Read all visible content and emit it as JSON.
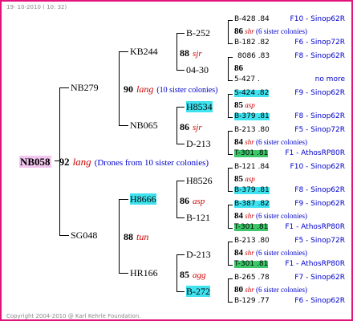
{
  "header": {
    "date": "19- 10-2010 ( 10: 32)"
  },
  "footer": {
    "copyright": "Copyright 2004-2010 @ Karl Kehrle Foundation."
  },
  "root": {
    "id": "NB058",
    "gen": "92",
    "origin": "lang",
    "note": "(Drones from 10 sister colonies)"
  },
  "gen2": [
    {
      "id": "NB279",
      "gen": "90",
      "origin": "lang",
      "note": "(10 sister colonies)"
    },
    {
      "id": "SG048",
      "gen": "88",
      "origin": "tun"
    }
  ],
  "gen3": [
    {
      "id": "KB244",
      "gen": "88",
      "origin": "sjr"
    },
    {
      "id": "NB065",
      "gen": "86",
      "origin": "sjr"
    },
    {
      "id": "H8666",
      "gen": "86",
      "origin": "asp"
    },
    {
      "id": "HR166",
      "gen": "85",
      "origin": "agg"
    }
  ],
  "gen4": [
    {
      "id": "B-252"
    },
    {
      "id": "04-30"
    },
    {
      "id": "H8534"
    },
    {
      "id": "D-213"
    },
    {
      "id": "H8526"
    },
    {
      "id": "B-121"
    },
    {
      "id": "D-213"
    },
    {
      "id": "B-272"
    }
  ],
  "gen5": [
    {
      "a": "B-428 .84",
      "a_src": "F10 - Sinop62R",
      "gen": "86",
      "origin": "shr",
      "note": "(6 sister colonies)",
      "b": "B-182 .82",
      "b_src": "F6 - Sinop72R"
    },
    {
      "a": "8086 .83",
      "a_src": "F8 - Sinop62R",
      "gen": "86",
      "origin": "",
      "note": "",
      "b": "5-427 .",
      "b_src": "no more"
    },
    {
      "a": "S-424 .82",
      "a_src": "F9 - Sinop62R",
      "gen": "85",
      "origin": "asp",
      "note": "",
      "b": "B-379 .81",
      "b_src": "F8 - Sinop62R"
    },
    {
      "a": "B-213 .80",
      "a_src": "F5 - Sinop72R",
      "gen": "84",
      "origin": "shr",
      "note": "(6 sister colonies)",
      "b": "T-301 .81",
      "b_src": "F1 - AthosRP80R"
    },
    {
      "a": "B-121 .84",
      "a_src": "F10 - Sinop62R",
      "gen": "85",
      "origin": "asp",
      "note": "",
      "b": "B-379 .81",
      "b_src": "F8 - Sinop62R"
    },
    {
      "a": "B-387 .82",
      "a_src": "F9 - Sinop62R",
      "gen": "84",
      "origin": "shr",
      "note": "(6 sister colonies)",
      "b": "T-301 .81",
      "b_src": "F1 - AthosRP80R"
    },
    {
      "a": "B-213 .80",
      "a_src": "F5 - Sinop72R",
      "gen": "84",
      "origin": "shr",
      "note": "(6 sister colonies)",
      "b": "T-301 .81",
      "b_src": "F1 - AthosRP80R"
    },
    {
      "a": "B-265 .78",
      "a_src": "F7 - Sinop62R",
      "gen": "80",
      "origin": "shr",
      "note": "(6 sister colonies)",
      "b": "B-129 .77",
      "b_src": "F6 - Sinop62R"
    }
  ],
  "colors": {
    "border": "#e0147c",
    "cyan": "#3fe3f0",
    "green": "#3cc86a",
    "pink": "#f3c6ef",
    "source_blue": "#0000cc",
    "origin_red": "#cc0000"
  }
}
